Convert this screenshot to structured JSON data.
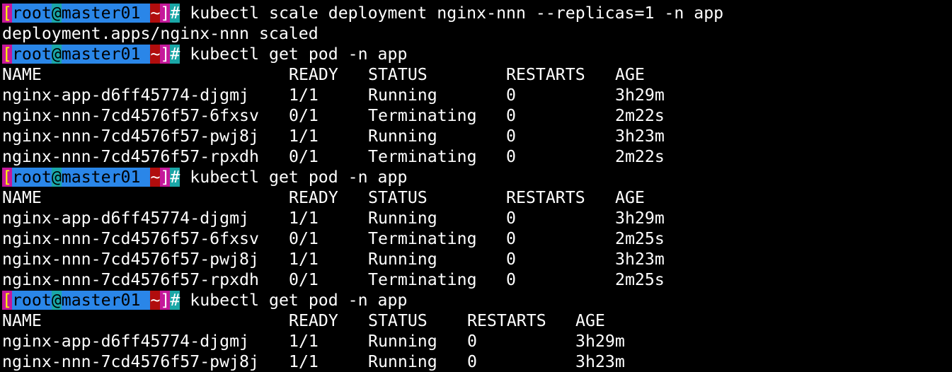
{
  "colors": {
    "background": "#000000",
    "text": "#ffffff",
    "bracket_bg": "#c5189b",
    "user_bg": "#2a86e8",
    "at_bg": "#1aa7a7",
    "tilde_bg": "#b10d0d"
  },
  "prompt": {
    "open": "[",
    "user": "root",
    "at": "@",
    "host": "master01",
    "dir": "~",
    "close": "]",
    "hash": "#"
  },
  "blocks": [
    {
      "command": "kubectl scale deployment nginx-nnn --replicas=1 -n app",
      "output": "deployment.apps/nginx-nnn scaled"
    },
    {
      "command": "kubectl get pod -n app",
      "headers": [
        "NAME",
        "READY",
        "STATUS",
        "RESTARTS",
        "AGE"
      ],
      "rows": [
        [
          "nginx-app-d6ff45774-djgmj",
          "1/1",
          "Running",
          "0",
          "3h29m"
        ],
        [
          "nginx-nnn-7cd4576f57-6fxsv",
          "0/1",
          "Terminating",
          "0",
          "2m22s"
        ],
        [
          "nginx-nnn-7cd4576f57-pwj8j",
          "1/1",
          "Running",
          "0",
          "3h23m"
        ],
        [
          "nginx-nnn-7cd4576f57-rpxdh",
          "0/1",
          "Terminating",
          "0",
          "2m22s"
        ]
      ]
    },
    {
      "command": "kubectl get pod -n app",
      "headers": [
        "NAME",
        "READY",
        "STATUS",
        "RESTARTS",
        "AGE"
      ],
      "rows": [
        [
          "nginx-app-d6ff45774-djgmj",
          "1/1",
          "Running",
          "0",
          "3h29m"
        ],
        [
          "nginx-nnn-7cd4576f57-6fxsv",
          "0/1",
          "Terminating",
          "0",
          "2m25s"
        ],
        [
          "nginx-nnn-7cd4576f57-pwj8j",
          "1/1",
          "Running",
          "0",
          "3h23m"
        ],
        [
          "nginx-nnn-7cd4576f57-rpxdh",
          "0/1",
          "Terminating",
          "0",
          "2m25s"
        ]
      ]
    },
    {
      "command": "kubectl get pod -n app",
      "headers": [
        "NAME",
        "READY",
        "STATUS",
        "RESTARTS",
        "AGE"
      ],
      "rows": [
        [
          "nginx-app-d6ff45774-djgmj",
          "1/1",
          "Running",
          "0",
          "3h29m"
        ],
        [
          "nginx-nnn-7cd4576f57-pwj8j",
          "1/1",
          "Running",
          "0",
          "3h23m"
        ]
      ]
    }
  ]
}
